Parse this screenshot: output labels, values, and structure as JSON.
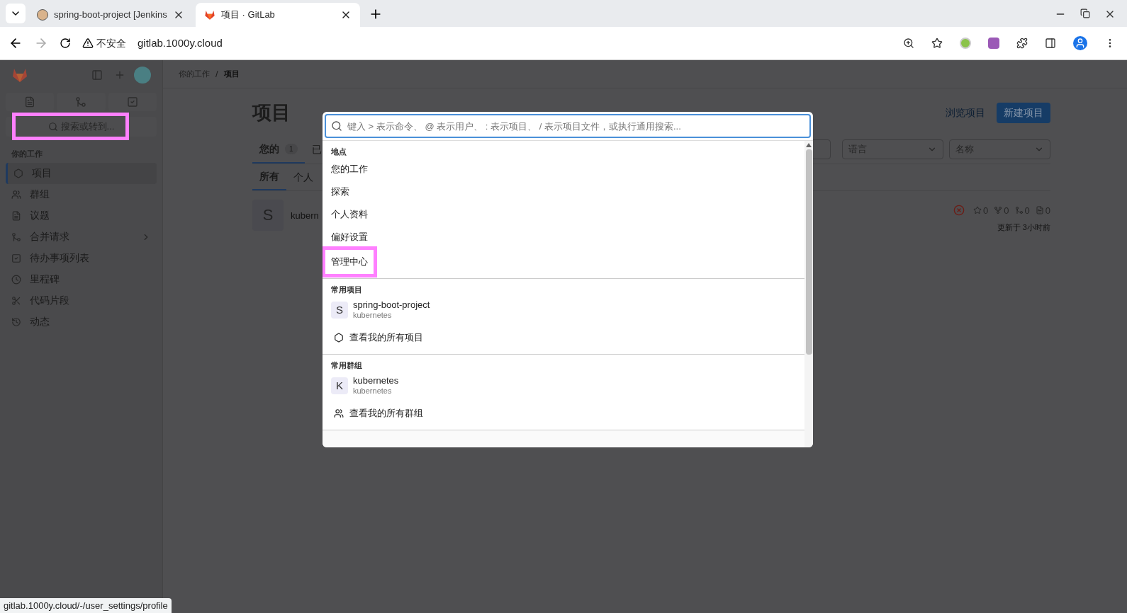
{
  "browser": {
    "tabs": [
      {
        "title": "spring-boot-project [Jenkins",
        "selected": false
      },
      {
        "title": "项目 · GitLab",
        "selected": true
      }
    ],
    "security_label": "不安全",
    "url": "gitlab.1000y.cloud"
  },
  "sidebar": {
    "search": "搜索或转到...",
    "section": "你的工作",
    "items": [
      {
        "label": "项目",
        "selected": true,
        "expandable": false
      },
      {
        "label": "群组",
        "selected": false,
        "expandable": false
      },
      {
        "label": "议题",
        "selected": false,
        "expandable": false
      },
      {
        "label": "合并请求",
        "selected": false,
        "expandable": true
      },
      {
        "label": "待办事项列表",
        "selected": false,
        "expandable": false
      },
      {
        "label": "里程碑",
        "selected": false,
        "expandable": false
      },
      {
        "label": "代码片段",
        "selected": false,
        "expandable": false
      },
      {
        "label": "动态",
        "selected": false,
        "expandable": false
      }
    ]
  },
  "breadcrumb": [
    "你的工作",
    "项目"
  ],
  "breadcrumb_separator": "/",
  "page": {
    "title": "项目",
    "explore_link": "浏览项目",
    "new_button": "新建项目",
    "tabs": [
      {
        "label": "您的",
        "count": "1",
        "selected": true
      },
      {
        "label": "已",
        "selected": false
      }
    ],
    "subtabs": [
      {
        "label": "所有",
        "selected": true
      },
      {
        "label": "个人",
        "selected": false
      }
    ],
    "filters": [
      "语言",
      "名称"
    ],
    "project": {
      "avatar": "S",
      "name": "kubern",
      "stars": "0",
      "forks": "0",
      "merge_requests": "0",
      "issues": "0",
      "updated": "更新于 3小时前"
    }
  },
  "search_dialog": {
    "placeholder": "键入 > 表示命令、 @ 表示用户、 : 表示项目、 / 表示项目文件，或执行通用搜索...",
    "sections": [
      {
        "title": "地点",
        "items": [
          {
            "kind": "place",
            "label": "您的工作",
            "highlighted": false
          },
          {
            "kind": "place",
            "label": "探索",
            "highlighted": false
          },
          {
            "kind": "place",
            "label": "个人资料",
            "highlighted": false
          },
          {
            "kind": "place",
            "label": "偏好设置",
            "highlighted": false
          },
          {
            "kind": "place",
            "label": "管理中心",
            "highlighted": true
          }
        ]
      },
      {
        "title": "常用项目",
        "items": [
          {
            "kind": "entity",
            "avatar": "S",
            "label": "spring-boot-project",
            "sub": "kubernetes"
          },
          {
            "kind": "link",
            "label": "查看我的所有项目"
          }
        ]
      },
      {
        "title": "常用群组",
        "items": [
          {
            "kind": "entity",
            "avatar": "K",
            "label": "kubernetes",
            "sub": "kubernetes"
          },
          {
            "kind": "link",
            "label": "查看我的所有群组"
          }
        ]
      }
    ]
  },
  "status_url": "gitlab.1000y.cloud/-/user_settings/profile"
}
